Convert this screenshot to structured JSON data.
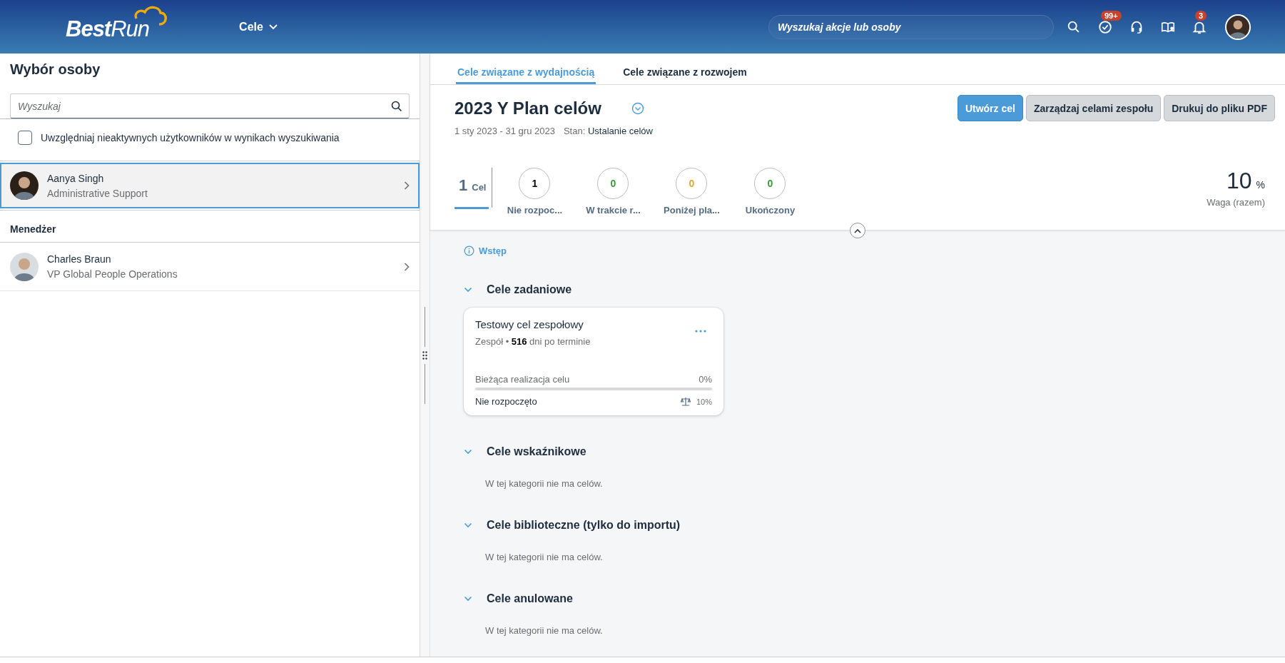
{
  "header": {
    "logo": "**Best**Run",
    "menu": {
      "label": "Cele"
    },
    "search": {
      "placeholder": "Wyszukaj akcje lub osoby"
    },
    "actions": [
      {
        "kind": "search"
      },
      {
        "kind": "todo",
        "badge": "99+"
      },
      {
        "kind": "support"
      },
      {
        "kind": "learning"
      },
      {
        "kind": "notifications",
        "badge": "3"
      }
    ]
  },
  "person_panel": {
    "title": "Wybór osoby",
    "search": {
      "placeholder": "Wyszukaj"
    },
    "include_inactive": {
      "label": "Uwzględniaj nieaktywnych użytkowników w wynikach wyszukiwania",
      "checked": false
    },
    "people": [
      {
        "name": "Aanya Singh",
        "role": "Administrative Support",
        "selected": true
      }
    ],
    "manager_heading": "Menedżer",
    "managers": [
      {
        "name": "Charles Braun",
        "role": "VP Global People Operations",
        "selected": false
      }
    ]
  },
  "tabs": [
    {
      "label": "Cele związane z wydajnością",
      "selected": true
    },
    {
      "label": "Cele związane z rozwojem",
      "selected": false
    }
  ],
  "plan": {
    "title": "2023 Y Plan celów",
    "dates": "1 sty 2023 - 31 gru 2023",
    "status_label": "Stan:",
    "status": "Ustalanie celów",
    "buttons": [
      {
        "label": "Utwórz cel",
        "kind": "primary"
      },
      {
        "label": "Zarządzaj celami zespołu",
        "kind": "secondary"
      },
      {
        "label": "Drukuj do pliku PDF",
        "kind": "secondary"
      }
    ],
    "total": {
      "count": "1",
      "label": "Cel",
      "selected": true
    },
    "statuses": [
      {
        "count": "1",
        "label": "Nie rozpoc...",
        "color": "#000000"
      },
      {
        "count": "0",
        "label": "W trakcie r...",
        "color": "#3a9b3a"
      },
      {
        "count": "0",
        "label": "Poniżej pla...",
        "color": "#e6a532"
      },
      {
        "count": "0",
        "label": "Ukończony",
        "color": "#3a9b3a"
      }
    ],
    "weight": {
      "value": "10",
      "unit": "%",
      "label": "Waga (razem)"
    }
  },
  "intro_link": "Wstęp",
  "sections": [
    {
      "title": "Cele zadaniowe",
      "expanded": true,
      "goals": [
        {
          "title": "Testowy cel zespołowy",
          "meta": "Zespół • **516** dni po terminie",
          "progress_label": "Bieżąca realizacja celu",
          "progress_value": "0%",
          "level": 0,
          "status": "Nie rozpoczęto",
          "weight": "10%"
        }
      ]
    },
    {
      "title": "Cele wskaźnikowe",
      "expanded": true,
      "empty_text": "W tej kategorii nie ma celów."
    },
    {
      "title": "Cele biblioteczne (tylko do importu)",
      "expanded": true,
      "empty_text": "W tej kategorii nie ma celów."
    },
    {
      "title": "Cele anulowane",
      "expanded": true,
      "empty_text": "W tej kategorii nie ma celów."
    }
  ]
}
